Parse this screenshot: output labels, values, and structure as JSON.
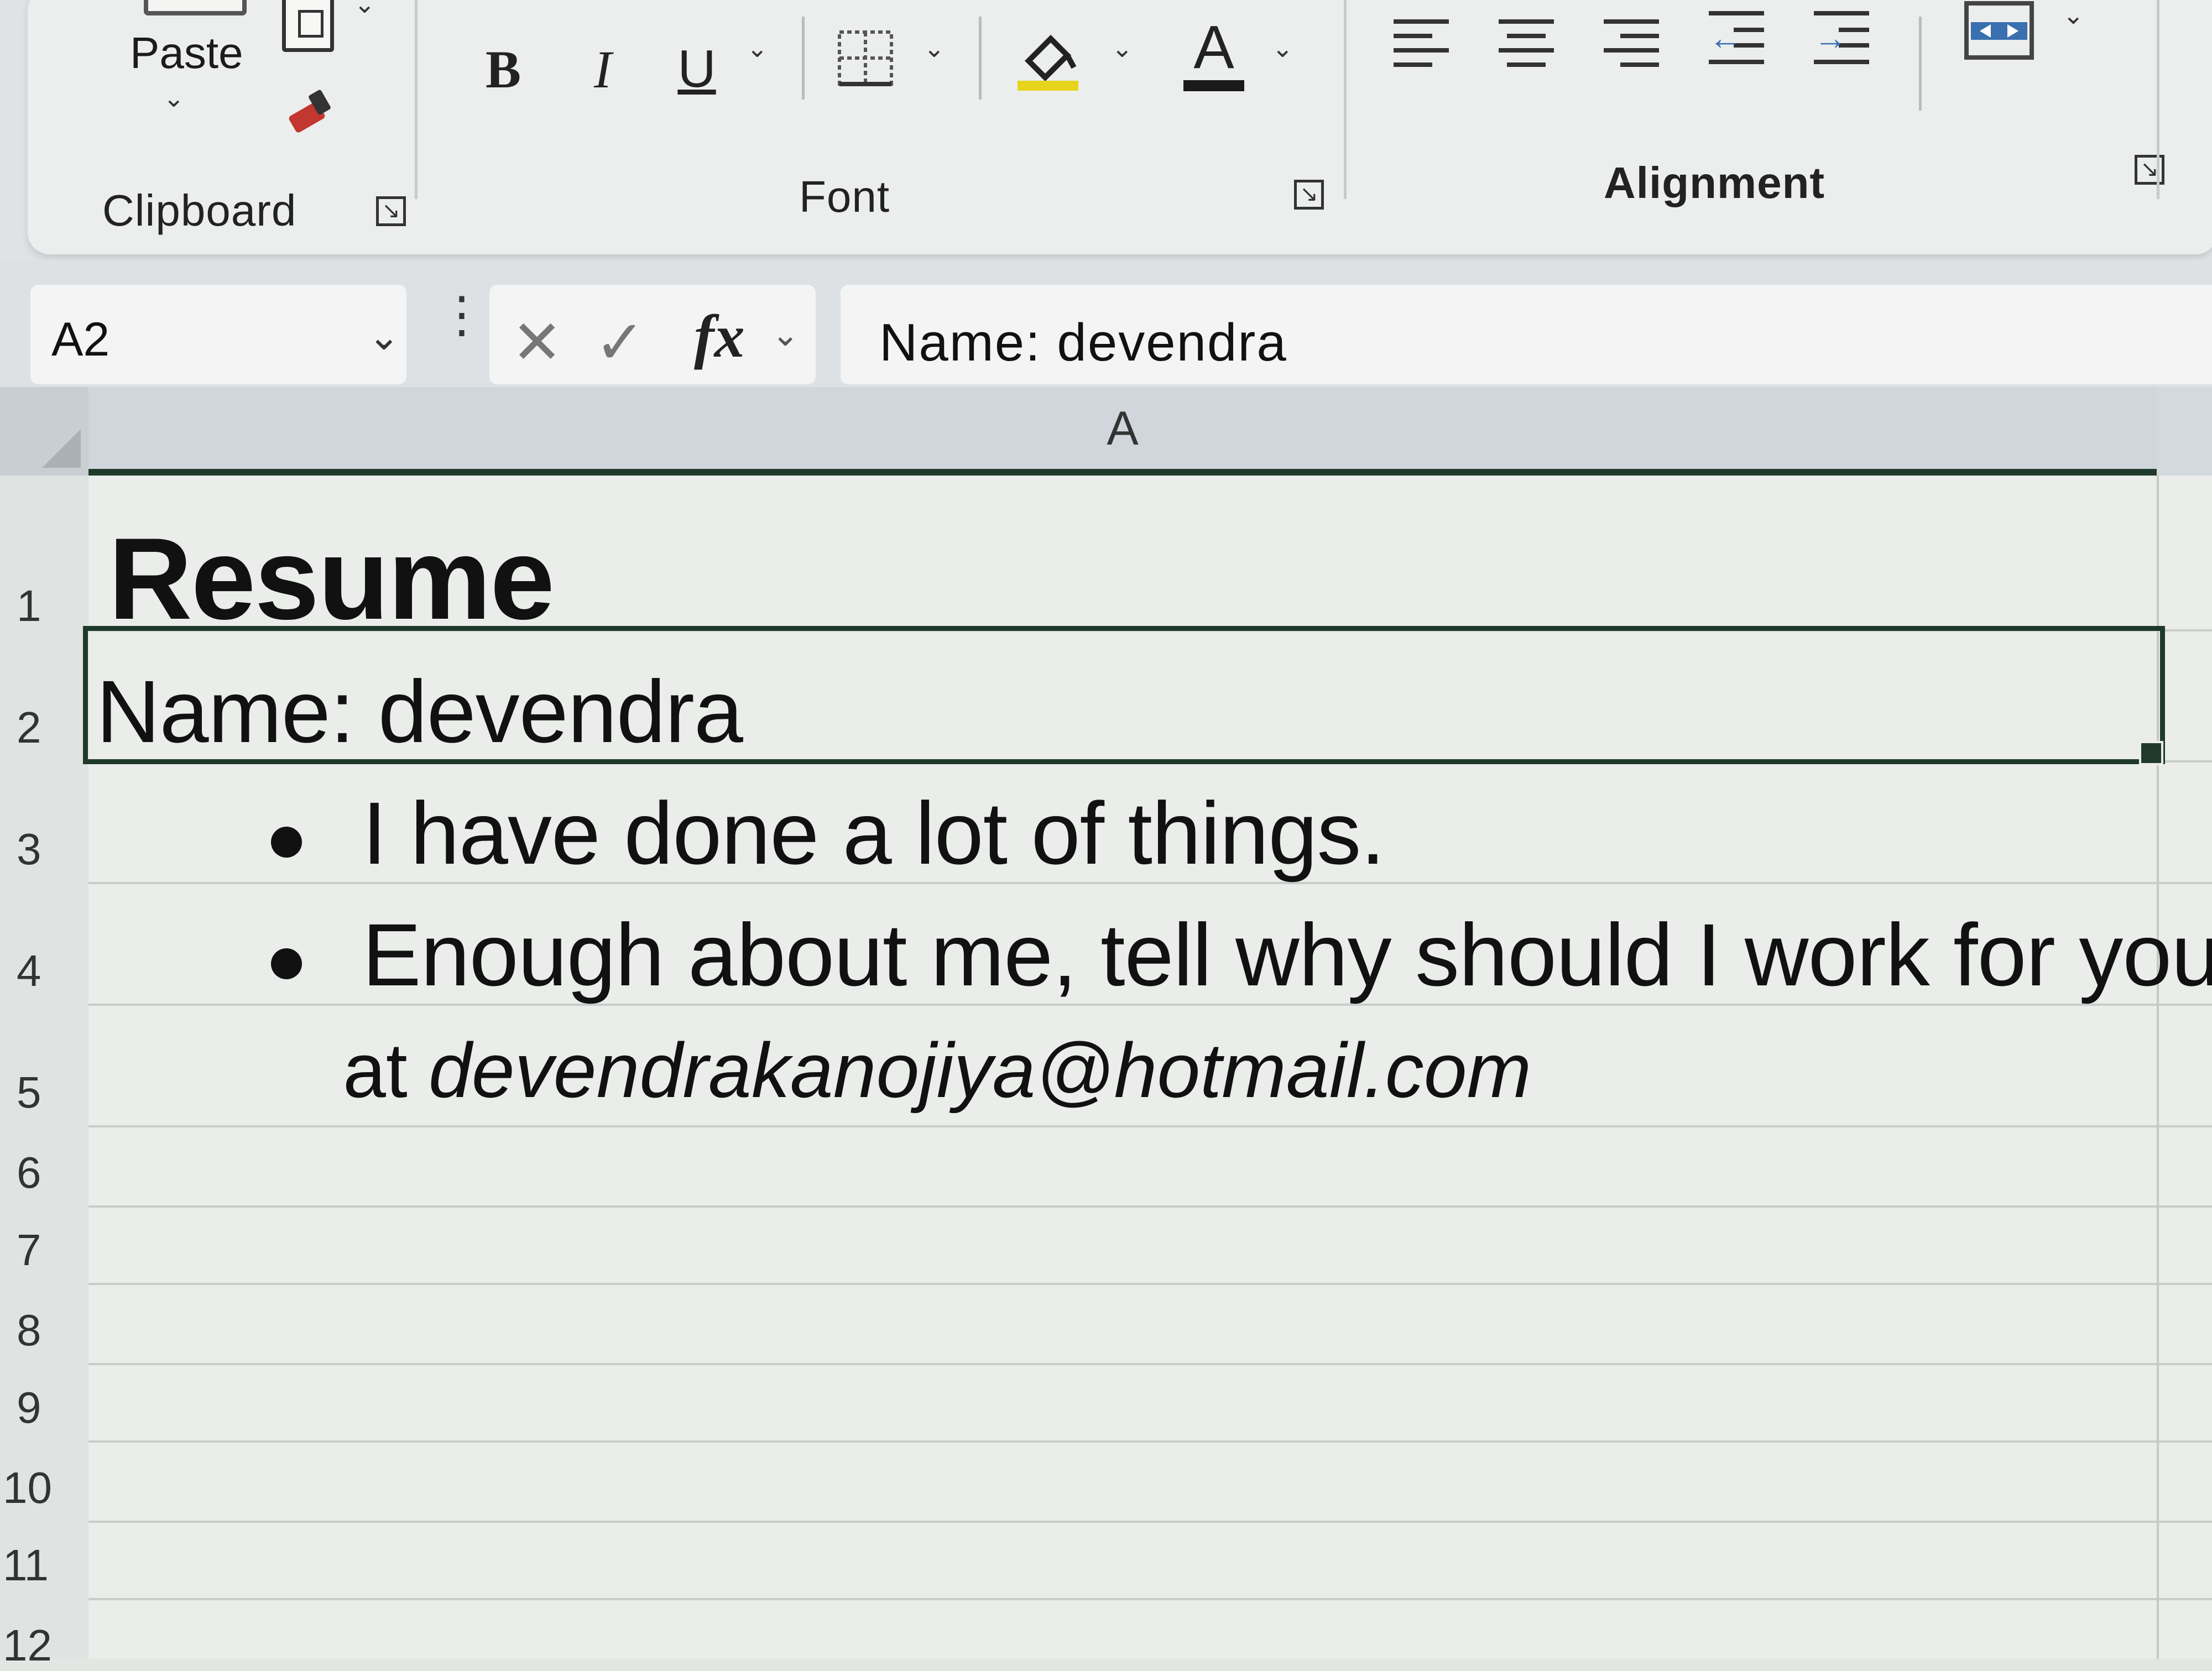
{
  "ribbon": {
    "groups": {
      "clipboard": "Clipboard",
      "font": "Font",
      "alignment": "Alignment"
    },
    "paste_label": "Paste",
    "bold": "B",
    "italic": "I",
    "underline": "U",
    "font_color_letter": "A"
  },
  "formula_bar": {
    "name_box": "A2",
    "fx": "fx",
    "formula": "Name: devendra"
  },
  "grid": {
    "column_headers": [
      "A"
    ],
    "row_numbers": [
      "1",
      "2",
      "3",
      "4",
      "5",
      "6",
      "7",
      "8",
      "9",
      "10",
      "11",
      "12"
    ],
    "cells": {
      "A1": "Resume",
      "A2": "Name: devendra",
      "A3": "I have done a lot of things.",
      "A4": "Enough about me, tell why should I work for you?",
      "A5_prefix": "at",
      "A5_email": "devendrakanojiya@hotmail.com"
    },
    "selected_cell": "A2"
  },
  "colors": {
    "highlight": "#e6d51c",
    "font_color": "#1a1a1a",
    "selection": "#1f3a2b"
  }
}
